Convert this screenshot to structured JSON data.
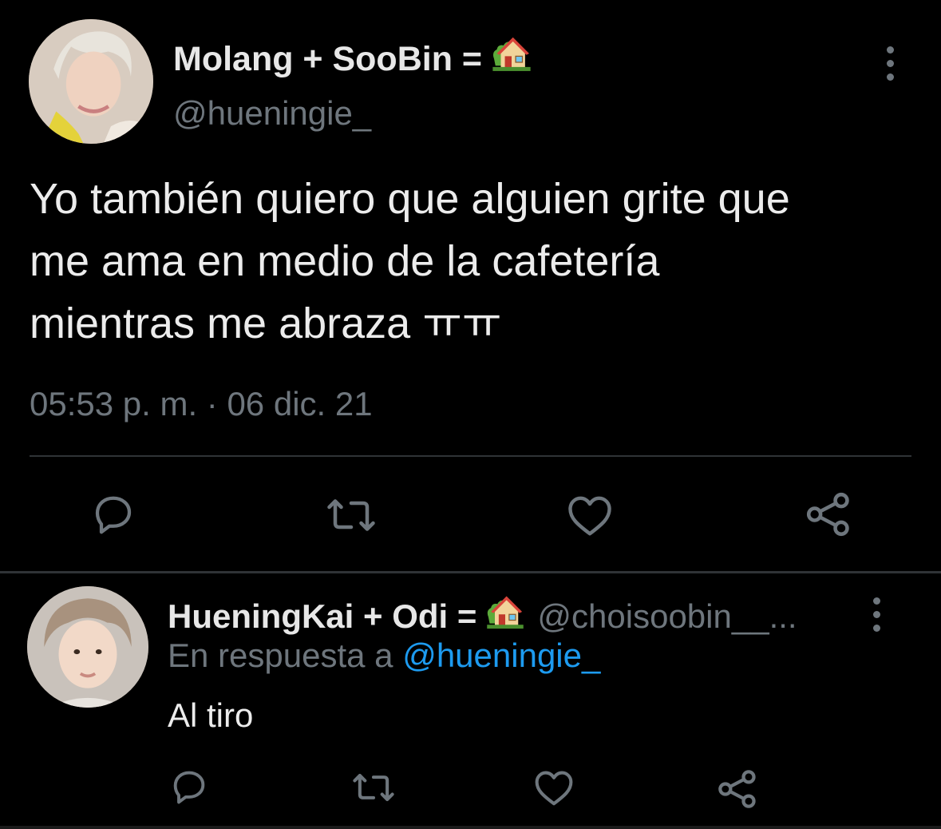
{
  "main_tweet": {
    "display_name": "Molang  + SooBin =",
    "name_emoji": "house-with-garden-icon",
    "handle": "@hueningie_",
    "text": "Yo también quiero que alguien grite que\nme ama en medio de la cafetería\nmientras me abraza  ㅠㅠ",
    "timestamp": "05:53 p. m. · 06 dic. 21"
  },
  "reply_tweet": {
    "display_name": "HueningKai + Odi =",
    "name_emoji": "house-with-garden-icon",
    "handle": "@choisoobin__...",
    "reply_prefix": "En respuesta a",
    "reply_mention": "@hueningie_",
    "text": "Al tiro"
  },
  "actions": [
    "reply-icon",
    "retweet-icon",
    "like-icon",
    "share-icon"
  ],
  "colors": {
    "background": "#000000",
    "primary_text": "#e7e7e7",
    "secondary_text": "#6e767d",
    "mention": "#1d9bf0",
    "divider": "#2f3336"
  }
}
